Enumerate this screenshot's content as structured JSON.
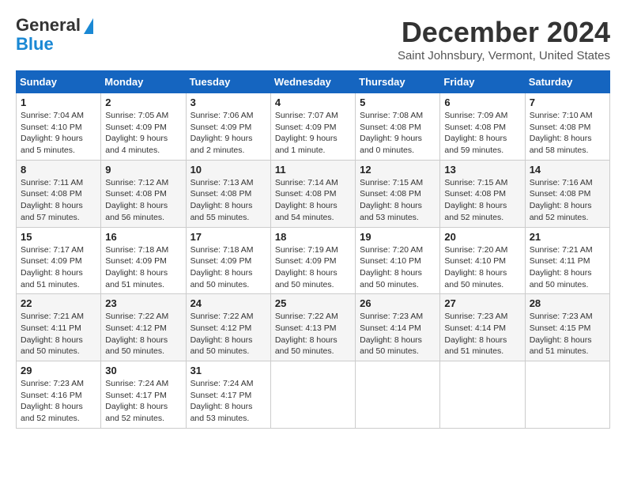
{
  "header": {
    "logo_line1": "General",
    "logo_line2": "Blue",
    "month": "December 2024",
    "location": "Saint Johnsbury, Vermont, United States"
  },
  "weekdays": [
    "Sunday",
    "Monday",
    "Tuesday",
    "Wednesday",
    "Thursday",
    "Friday",
    "Saturday"
  ],
  "weeks": [
    [
      {
        "day": 1,
        "sunrise": "7:04 AM",
        "sunset": "4:10 PM",
        "daylight": "9 hours and 5 minutes."
      },
      {
        "day": 2,
        "sunrise": "7:05 AM",
        "sunset": "4:09 PM",
        "daylight": "9 hours and 4 minutes."
      },
      {
        "day": 3,
        "sunrise": "7:06 AM",
        "sunset": "4:09 PM",
        "daylight": "9 hours and 2 minutes."
      },
      {
        "day": 4,
        "sunrise": "7:07 AM",
        "sunset": "4:09 PM",
        "daylight": "9 hours and 1 minute."
      },
      {
        "day": 5,
        "sunrise": "7:08 AM",
        "sunset": "4:08 PM",
        "daylight": "9 hours and 0 minutes."
      },
      {
        "day": 6,
        "sunrise": "7:09 AM",
        "sunset": "4:08 PM",
        "daylight": "8 hours and 59 minutes."
      },
      {
        "day": 7,
        "sunrise": "7:10 AM",
        "sunset": "4:08 PM",
        "daylight": "8 hours and 58 minutes."
      }
    ],
    [
      {
        "day": 8,
        "sunrise": "7:11 AM",
        "sunset": "4:08 PM",
        "daylight": "8 hours and 57 minutes."
      },
      {
        "day": 9,
        "sunrise": "7:12 AM",
        "sunset": "4:08 PM",
        "daylight": "8 hours and 56 minutes."
      },
      {
        "day": 10,
        "sunrise": "7:13 AM",
        "sunset": "4:08 PM",
        "daylight": "8 hours and 55 minutes."
      },
      {
        "day": 11,
        "sunrise": "7:14 AM",
        "sunset": "4:08 PM",
        "daylight": "8 hours and 54 minutes."
      },
      {
        "day": 12,
        "sunrise": "7:15 AM",
        "sunset": "4:08 PM",
        "daylight": "8 hours and 53 minutes."
      },
      {
        "day": 13,
        "sunrise": "7:15 AM",
        "sunset": "4:08 PM",
        "daylight": "8 hours and 52 minutes."
      },
      {
        "day": 14,
        "sunrise": "7:16 AM",
        "sunset": "4:08 PM",
        "daylight": "8 hours and 52 minutes."
      }
    ],
    [
      {
        "day": 15,
        "sunrise": "7:17 AM",
        "sunset": "4:09 PM",
        "daylight": "8 hours and 51 minutes."
      },
      {
        "day": 16,
        "sunrise": "7:18 AM",
        "sunset": "4:09 PM",
        "daylight": "8 hours and 51 minutes."
      },
      {
        "day": 17,
        "sunrise": "7:18 AM",
        "sunset": "4:09 PM",
        "daylight": "8 hours and 50 minutes."
      },
      {
        "day": 18,
        "sunrise": "7:19 AM",
        "sunset": "4:09 PM",
        "daylight": "8 hours and 50 minutes."
      },
      {
        "day": 19,
        "sunrise": "7:20 AM",
        "sunset": "4:10 PM",
        "daylight": "8 hours and 50 minutes."
      },
      {
        "day": 20,
        "sunrise": "7:20 AM",
        "sunset": "4:10 PM",
        "daylight": "8 hours and 50 minutes."
      },
      {
        "day": 21,
        "sunrise": "7:21 AM",
        "sunset": "4:11 PM",
        "daylight": "8 hours and 50 minutes."
      }
    ],
    [
      {
        "day": 22,
        "sunrise": "7:21 AM",
        "sunset": "4:11 PM",
        "daylight": "8 hours and 50 minutes."
      },
      {
        "day": 23,
        "sunrise": "7:22 AM",
        "sunset": "4:12 PM",
        "daylight": "8 hours and 50 minutes."
      },
      {
        "day": 24,
        "sunrise": "7:22 AM",
        "sunset": "4:12 PM",
        "daylight": "8 hours and 50 minutes."
      },
      {
        "day": 25,
        "sunrise": "7:22 AM",
        "sunset": "4:13 PM",
        "daylight": "8 hours and 50 minutes."
      },
      {
        "day": 26,
        "sunrise": "7:23 AM",
        "sunset": "4:14 PM",
        "daylight": "8 hours and 50 minutes."
      },
      {
        "day": 27,
        "sunrise": "7:23 AM",
        "sunset": "4:14 PM",
        "daylight": "8 hours and 51 minutes."
      },
      {
        "day": 28,
        "sunrise": "7:23 AM",
        "sunset": "4:15 PM",
        "daylight": "8 hours and 51 minutes."
      }
    ],
    [
      {
        "day": 29,
        "sunrise": "7:23 AM",
        "sunset": "4:16 PM",
        "daylight": "8 hours and 52 minutes."
      },
      {
        "day": 30,
        "sunrise": "7:24 AM",
        "sunset": "4:17 PM",
        "daylight": "8 hours and 52 minutes."
      },
      {
        "day": 31,
        "sunrise": "7:24 AM",
        "sunset": "4:17 PM",
        "daylight": "8 hours and 53 minutes."
      },
      null,
      null,
      null,
      null
    ]
  ]
}
